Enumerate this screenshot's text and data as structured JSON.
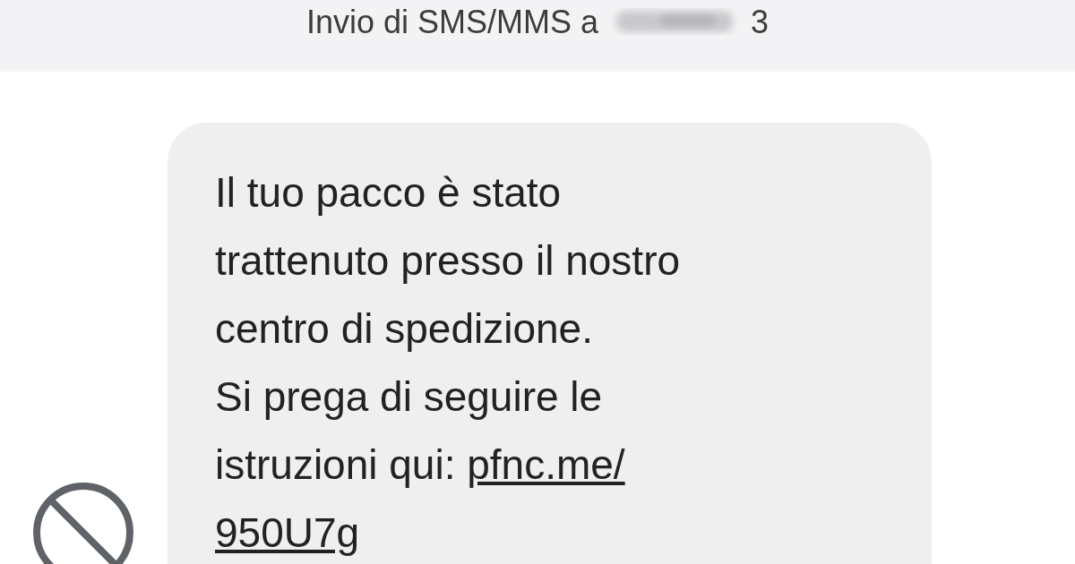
{
  "header": {
    "title": "Invio di SMS/MMS a",
    "number_tail": "3"
  },
  "message": {
    "lines": [
      "Il tuo pacco è stato",
      "trattenuto presso il nostro",
      "centro di spedizione.",
      "Si prega di seguire le",
      "istruzioni qui: "
    ],
    "link_parts": [
      "pfnc.me/",
      "950U7g"
    ]
  }
}
